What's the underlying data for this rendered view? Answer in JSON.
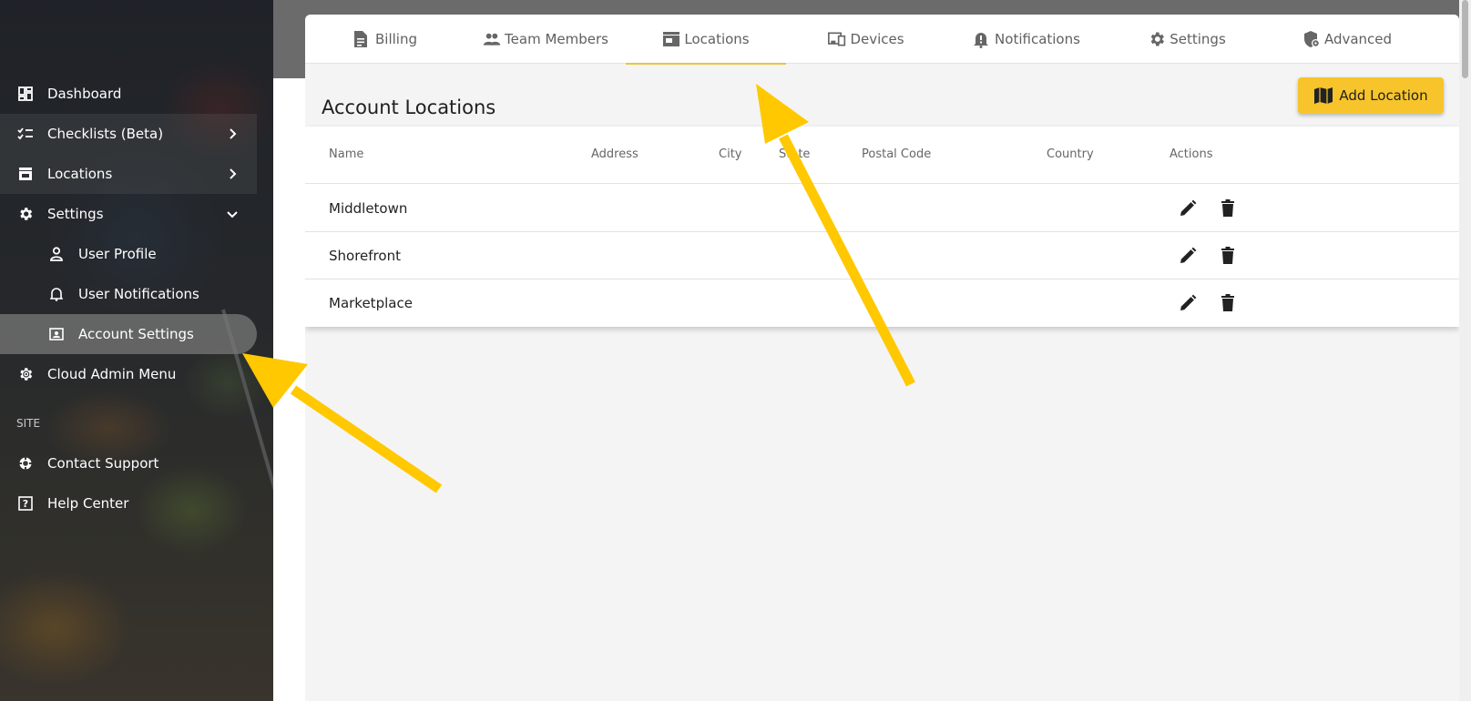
{
  "sidebar": {
    "items": [
      {
        "label": "Dashboard",
        "icon": "dashboard-icon"
      },
      {
        "label": "Checklists (Beta)",
        "icon": "checklist-icon",
        "chevron": "chevron-right-icon"
      },
      {
        "label": "Locations",
        "icon": "store-icon",
        "chevron": "chevron-right-icon"
      },
      {
        "label": "Settings",
        "icon": "gear-icon",
        "chevron": "chevron-down-icon"
      },
      {
        "label": "User Profile",
        "icon": "person-icon"
      },
      {
        "label": "User Notifications",
        "icon": "bell-icon"
      },
      {
        "label": "Account Settings",
        "icon": "account-box-icon",
        "active": true
      },
      {
        "label": "Cloud Admin Menu",
        "icon": "admin-gear-icon"
      }
    ],
    "section_label": "SITE",
    "site_items": [
      {
        "label": "Contact Support",
        "icon": "lifebuoy-icon"
      },
      {
        "label": "Help Center",
        "icon": "help-box-icon"
      }
    ]
  },
  "tabs": [
    {
      "label": "Billing",
      "icon": "document-icon"
    },
    {
      "label": "Team Members",
      "icon": "people-icon"
    },
    {
      "label": "Locations",
      "icon": "store-icon",
      "active": true
    },
    {
      "label": "Devices",
      "icon": "devices-icon"
    },
    {
      "label": "Notifications",
      "icon": "bell-alert-icon"
    },
    {
      "label": "Settings",
      "icon": "gear-icon"
    },
    {
      "label": "Advanced",
      "icon": "shield-gear-icon"
    }
  ],
  "page": {
    "title": "Account Locations",
    "add_button": "Add Location"
  },
  "table": {
    "headers": [
      "Name",
      "Address",
      "City",
      "State",
      "Postal Code",
      "Country",
      "Actions"
    ],
    "rows": [
      {
        "name": "Middletown"
      },
      {
        "name": "Shorefront"
      },
      {
        "name": "Marketplace"
      }
    ]
  },
  "colors": {
    "accent": "#f7c52b",
    "tab_underline": "#e9c53b",
    "annotation_arrow": "#ffc800"
  }
}
